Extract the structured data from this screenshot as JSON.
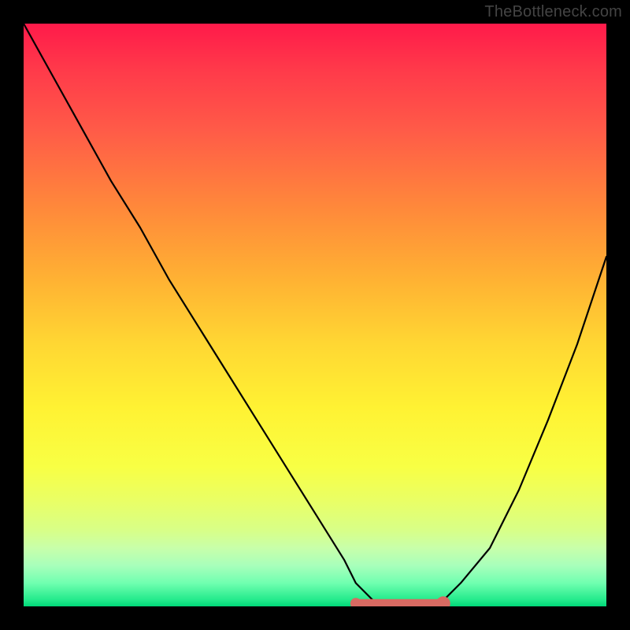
{
  "watermark": "TheBottleneck.com",
  "colors": {
    "curve": "#000000",
    "highlight": "#d86a62",
    "gradient_top": "#ff1a4a",
    "gradient_bottom": "#00d878"
  },
  "chart_data": {
    "type": "line",
    "title": "",
    "xlabel": "",
    "ylabel": "",
    "xlim": [
      0,
      100
    ],
    "ylim": [
      0,
      100
    ],
    "grid": false,
    "series": [
      {
        "name": "bottleneck-curve",
        "x": [
          0,
          5,
          10,
          15,
          20,
          25,
          30,
          35,
          40,
          45,
          50,
          55,
          57,
          60,
          63,
          67,
          72,
          75,
          80,
          85,
          90,
          95,
          100
        ],
        "y": [
          100,
          91,
          82,
          73,
          65,
          56,
          48,
          40,
          32,
          24,
          16,
          8,
          4,
          1,
          0,
          0,
          1,
          4,
          10,
          20,
          32,
          45,
          60
        ]
      }
    ],
    "annotations": [
      {
        "name": "valley-highlight",
        "kind": "segment",
        "x_start": 57,
        "x_end": 72,
        "y": 0.5,
        "color": "#d86a62"
      }
    ]
  }
}
